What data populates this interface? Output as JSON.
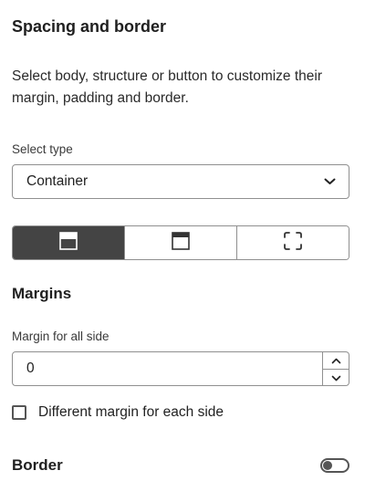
{
  "panel": {
    "title": "Spacing and border",
    "description": "Select body, structure or button to customize their margin, padding and border."
  },
  "select_type": {
    "label": "Select type",
    "value": "Container",
    "icon": "chevron-down-icon"
  },
  "segmented": {
    "buttons": [
      {
        "icon": "layout-top-bar-icon",
        "active": true
      },
      {
        "icon": "layout-header-icon",
        "active": false
      },
      {
        "icon": "corners-frame-icon",
        "active": false
      }
    ]
  },
  "margins": {
    "heading": "Margins",
    "label": "Margin for all side",
    "value": "0",
    "checkbox_label": "Different margin for each side",
    "checkbox_checked": false
  },
  "border": {
    "heading": "Border",
    "enabled": false
  },
  "colors": {
    "active_segment": "#444444",
    "border": "#909090"
  }
}
